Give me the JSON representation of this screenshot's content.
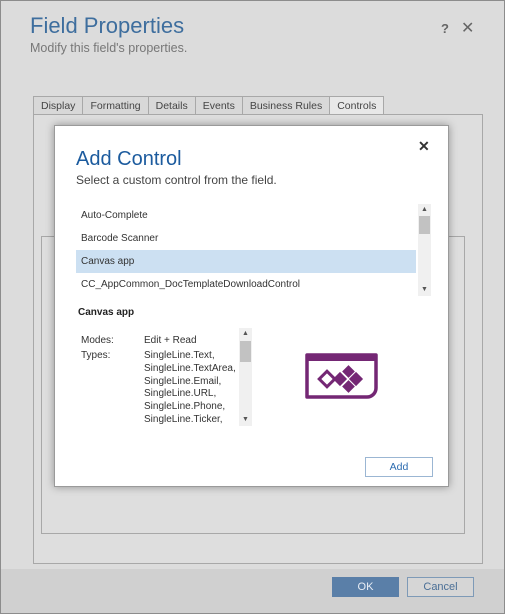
{
  "background": {
    "title": "Field Properties",
    "subtitle": "Modify this field's properties.",
    "help_icon": "?",
    "close_icon": "✕",
    "tabs": [
      {
        "label": "Display"
      },
      {
        "label": "Formatting"
      },
      {
        "label": "Details"
      },
      {
        "label": "Events"
      },
      {
        "label": "Business Rules"
      },
      {
        "label": "Controls"
      }
    ],
    "ok_label": "OK",
    "cancel_label": "Cancel"
  },
  "dialog": {
    "title": "Add Control",
    "subtitle": "Select a custom control from the field.",
    "close_icon": "✕",
    "controls": [
      {
        "label": "Auto-Complete"
      },
      {
        "label": "Barcode Scanner"
      },
      {
        "label": "Canvas app"
      },
      {
        "label": "CC_AppCommon_DocTemplateDownloadControl"
      }
    ],
    "selected_index": 2,
    "detail": {
      "name": "Canvas app",
      "modes_label": "Modes:",
      "modes_value": "Edit + Read",
      "types_label": "Types:",
      "types": "SingleLine.Text, SingleLine.TextArea, SingleLine.Email, SingleLine.URL, SingleLine.Phone, SingleLine.Ticker,",
      "icon": "power-apps-icon"
    },
    "add_label": "Add"
  },
  "colors": {
    "title_blue": "#1c5b9e",
    "selection": "#cce0f2",
    "icon_purple": "#742774",
    "ok_button": "#5a7fa8"
  }
}
